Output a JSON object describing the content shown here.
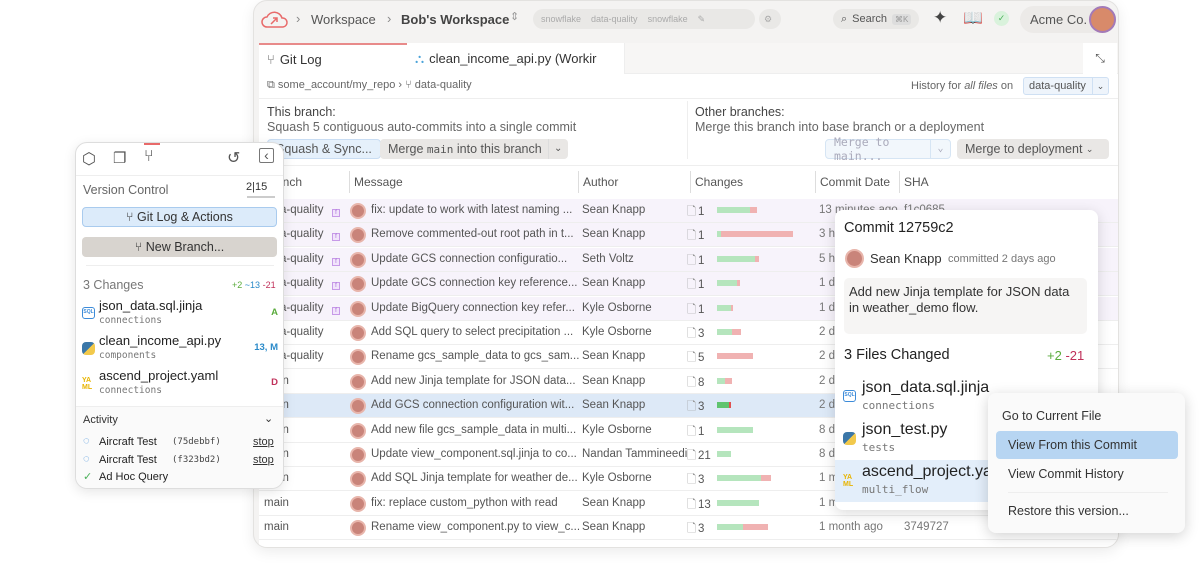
{
  "topbar": {
    "crumbs": [
      "Workspace",
      "Bob's Workspace"
    ],
    "pill": [
      "snowflake",
      "data-quality",
      "snowflake"
    ],
    "search": "Search",
    "shortcut": "⌘K",
    "org": "Acme Co."
  },
  "tabs": [
    {
      "label": "Git Log",
      "active": true
    },
    {
      "label": "clean_income_api.py (Workir",
      "active": false
    }
  ],
  "breadcrumb": {
    "repo": "some_account/my_repo",
    "branch": "data-quality"
  },
  "history": {
    "prefix": "History for",
    "em": "all files",
    "on": "on",
    "branch": "data-quality"
  },
  "this_branch": {
    "title": "This branch:",
    "desc": "Squash 5 contiguous auto-commits into a single commit",
    "squash": "Squash & Sync...",
    "merge_pre": "Merge",
    "merge_code": "main",
    "merge_post": "into this branch"
  },
  "other_branches": {
    "title": "Other branches:",
    "desc": "Merge this branch into base branch or a deployment",
    "merge_main": "Merge to main...",
    "merge_deploy": "Merge to deployment"
  },
  "columns": [
    "Branch",
    "Message",
    "Author",
    "Changes",
    "Commit Date",
    "SHA"
  ],
  "commits": [
    {
      "branch": "data-quality",
      "auto": true,
      "message": "fix: update to work with latest naming ...",
      "author": "Sean Knapp",
      "files": "1",
      "bar_add": 33,
      "bar_del": 7,
      "date": "13 minutes ago",
      "sha": "f1c0685"
    },
    {
      "branch": "data-quality",
      "auto": true,
      "message": "Remove commented-out root path in t...",
      "author": "Sean Knapp",
      "files": "1",
      "bar_add": 4,
      "bar_del": 72,
      "date": "3 hours ago",
      "sha": ""
    },
    {
      "branch": "data-quality",
      "auto": true,
      "message": "Update GCS connection configuratio...",
      "author": "Seth Voltz",
      "files": "1",
      "bar_add": 38,
      "bar_del": 4,
      "date": "5 hours ago",
      "sha": ""
    },
    {
      "branch": "data-quality",
      "auto": true,
      "message": "Update GCS connection key reference...",
      "author": "Sean Knapp",
      "files": "1",
      "bar_add": 20,
      "bar_del": 3,
      "date": "1 day ago",
      "sha": ""
    },
    {
      "branch": "data-quality",
      "auto": true,
      "message": "Update BigQuery connection key refer...",
      "author": "Kyle Osborne",
      "files": "1",
      "bar_add": 14,
      "bar_del": 2,
      "date": "1 day ago",
      "sha": ""
    },
    {
      "branch": "data-quality",
      "auto": false,
      "message": "Add SQL query to select precipitation ...",
      "author": "Kyle Osborne",
      "files": "3",
      "bar_add": 15,
      "bar_del": 9,
      "date": "2 days ago",
      "sha": ""
    },
    {
      "branch": "data-quality",
      "auto": false,
      "message": "Rename gcs_sample_data to gcs_sam...",
      "author": "Sean Knapp",
      "files": "5",
      "bar_add": 0,
      "bar_del": 36,
      "date": "2 days ago",
      "sha": ""
    },
    {
      "branch": "main",
      "auto": false,
      "message": "Add new Jinja template for JSON data...",
      "author": "Sean Knapp",
      "files": "8",
      "bar_add": 8,
      "bar_del": 7,
      "date": "2 days ago",
      "sha": ""
    },
    {
      "branch": "main",
      "auto": false,
      "selected": true,
      "message": "Add GCS connection configuration wit...",
      "author": "Sean Knapp",
      "files": "3",
      "bar_add": 12,
      "bar_del": 2,
      "date": "2 days ago",
      "sha": ""
    },
    {
      "branch": "main",
      "auto": false,
      "message": "Add new file gcs_sample_data in multi...",
      "author": "Kyle Osborne",
      "files": "1",
      "bar_add": 36,
      "bar_del": 0,
      "date": "8 days ago",
      "sha": ""
    },
    {
      "branch": "main",
      "auto": false,
      "message": "Update view_component.sql.jinja to co...",
      "author": "Nandan Tammineedi",
      "files": "21",
      "bar_add": 14,
      "bar_del": 0,
      "date": "8 days ago",
      "sha": ""
    },
    {
      "branch": "main",
      "auto": false,
      "message": "Add SQL Jinja template for weather de...",
      "author": "Kyle Osborne",
      "files": "3",
      "bar_add": 44,
      "bar_del": 10,
      "date": "1 month ago",
      "sha": ""
    },
    {
      "branch": "main",
      "auto": false,
      "message": "fix: replace custom_python with read",
      "author": "Sean Knapp",
      "files": "13",
      "bar_add": 42,
      "bar_del": 0,
      "date": "1 month ago",
      "sha": ""
    },
    {
      "branch": "main",
      "auto": false,
      "message": "Rename view_component.py to view_c...",
      "author": "Sean Knapp",
      "files": "3",
      "bar_add": 26,
      "bar_del": 25,
      "date": "1 month ago",
      "sha": "3749727"
    }
  ],
  "sidebar": {
    "title": "Version Control",
    "counter_a": "2",
    "counter_b": "15",
    "git_log": "Git Log & Actions",
    "new_branch": "New Branch...",
    "changes_title": "3 Changes",
    "plus": "+2",
    "tilde": "~13",
    "minus": "-21",
    "files": [
      {
        "name": "json_data.sql.jinja",
        "dir": "connections",
        "status": "A",
        "icon": "sql-icon",
        "color": "#5aab3c"
      },
      {
        "name": "clean_income_api.py",
        "dir": "components",
        "status": "13, M",
        "icon": "python-icon",
        "color": "#2a8ac9"
      },
      {
        "name": "ascend_project.yaml",
        "dir": "connections",
        "status": "D",
        "icon": "yaml-icon",
        "color": "#c0305a"
      }
    ],
    "activity_title": "Activity",
    "activity": [
      {
        "name": "Aircraft Test",
        "hash": "(75debbf)",
        "action": "stop",
        "state": "running"
      },
      {
        "name": "Aircraft Test",
        "hash": "(f323bd2)",
        "action": "stop",
        "state": "running"
      },
      {
        "name": "Ad Hoc Query",
        "hash": "",
        "action": "",
        "state": "done"
      }
    ]
  },
  "popup": {
    "title": "Commit 12759c2",
    "author": "Sean Knapp",
    "when": "committed 2 days ago",
    "message": "Add new Jinja template for JSON data in weather_demo flow.",
    "files_title": "3 Files Changed",
    "plus": "+2",
    "minus": "-21",
    "files": [
      {
        "name": "json_data.sql.jinja",
        "dir": "connections",
        "icon": "sql-icon"
      },
      {
        "name": "json_test.py",
        "dir": "tests",
        "icon": "python-icon"
      },
      {
        "name": "ascend_project.yaml",
        "dir": "multi_flow",
        "icon": "yaml-icon"
      }
    ]
  },
  "menu": [
    "Go to Current File",
    "View From this Commit",
    "View Commit History",
    "Restore this version..."
  ],
  "colors": {
    "accent_red": "#e86a6a",
    "add": "#b5e5bd",
    "del": "#f0b2b2",
    "selected": "#dde9f7",
    "auto_row": "#f7f3fb"
  }
}
